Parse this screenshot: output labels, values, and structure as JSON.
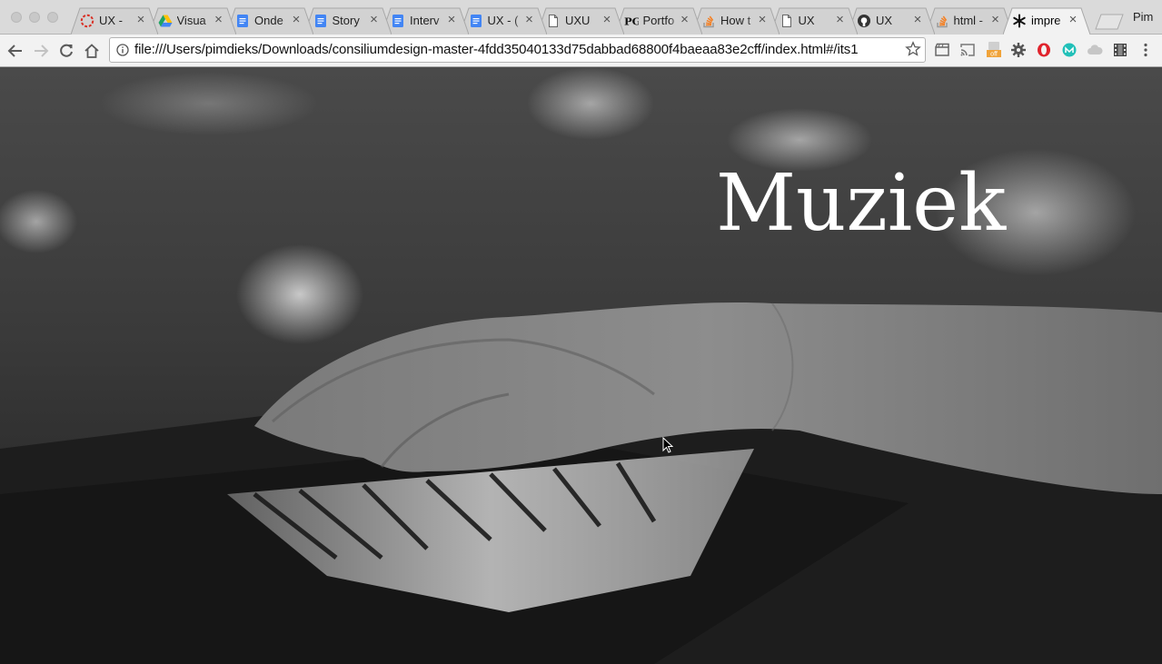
{
  "tabs": [
    {
      "title": "UX - ",
      "icon": "circle-dashed-icon",
      "color": "#d93025"
    },
    {
      "title": "Visua",
      "icon": "google-drive-icon",
      "color": "#1fa463"
    },
    {
      "title": "Onde",
      "icon": "google-docs-icon",
      "color": "#4285f4"
    },
    {
      "title": "Story",
      "icon": "google-docs-icon",
      "color": "#4285f4"
    },
    {
      "title": "Interv",
      "icon": "google-docs-icon",
      "color": "#4285f4"
    },
    {
      "title": "UX - (",
      "icon": "google-docs-icon",
      "color": "#4285f4"
    },
    {
      "title": "UXU",
      "icon": "file-icon",
      "color": "#666666"
    },
    {
      "title": "Portfo",
      "icon": "pg-logo-icon",
      "color": "#111111"
    },
    {
      "title": "How t",
      "icon": "stackoverflow-icon",
      "color": "#f48024"
    },
    {
      "title": "UX",
      "icon": "file-icon",
      "color": "#666666"
    },
    {
      "title": "UX",
      "icon": "github-icon",
      "color": "#333333"
    },
    {
      "title": "html -",
      "icon": "stackoverflow-icon",
      "color": "#f48024"
    },
    {
      "title": "impre",
      "icon": "asterisk-icon",
      "color": "#111111"
    }
  ],
  "active_tab_index": 12,
  "profile_name": "Pim",
  "close_glyph": "×",
  "address_bar": {
    "url": "file:///Users/pimdieks/Downloads/consiliumdesign-master-4fdd35040133d75dabbad68800f4baeaa83e2cff/index.html#/its1"
  },
  "extensions": [
    {
      "icon": "clapperboard-icon"
    },
    {
      "icon": "cast-icon"
    },
    {
      "icon": "off-badge-icon",
      "label": "off"
    },
    {
      "icon": "gear-icon"
    },
    {
      "icon": "opera-icon",
      "color": "#e0232c"
    },
    {
      "icon": "m-circle-icon",
      "color": "#21c0b8"
    },
    {
      "icon": "cloud-icon"
    },
    {
      "icon": "film-icon"
    },
    {
      "icon": "menu-icon"
    }
  ],
  "hero": {
    "title": "Muziek"
  }
}
